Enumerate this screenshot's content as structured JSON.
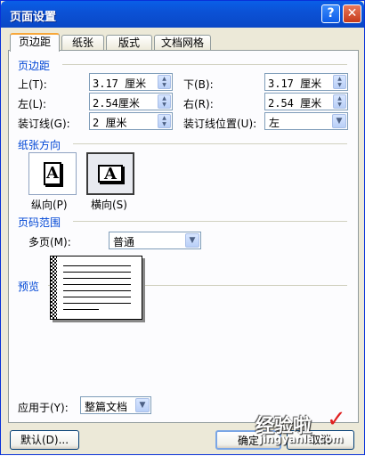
{
  "window": {
    "title": "页面设置",
    "help": "?",
    "close": "✕"
  },
  "tabs": [
    "页边距",
    "纸张",
    "版式",
    "文档网格"
  ],
  "margins": {
    "section_title": "页边距",
    "top_label": "上(T):",
    "top_value": "3.17 厘米",
    "bottom_label": "下(B):",
    "bottom_value": "3.17 厘米",
    "left_label": "左(L):",
    "left_value": "2.54厘米",
    "right_label": "右(R):",
    "right_value": "2.54 厘米",
    "gutter_label": "装订线(G):",
    "gutter_value": "2 厘米",
    "gutter_pos_label": "装订线位置(U):",
    "gutter_pos_value": "左"
  },
  "orientation": {
    "section_title": "纸张方向",
    "portrait_label": "纵向(P)",
    "landscape_label": "横向(S)",
    "glyph": "A",
    "selected": "landscape"
  },
  "pages": {
    "section_title": "页码范围",
    "multiple_label": "多页(M):",
    "multiple_value": "普通"
  },
  "preview": {
    "section_title": "预览",
    "apply_label": "应用于(Y):",
    "apply_value": "整篇文档"
  },
  "buttons": {
    "default": "默认(D)...",
    "ok": "确定",
    "cancel": "取消"
  },
  "watermark": {
    "main": "经验啦",
    "sub": "jingyanla.com",
    "check": "✓"
  },
  "icons": {
    "up": "▲",
    "down": "▼",
    "drop": "▼"
  },
  "colors": {
    "title_bar": "#0b52d6",
    "section": "#0046d5",
    "panel": "#fcfcfe",
    "window": "#ece9d8"
  }
}
